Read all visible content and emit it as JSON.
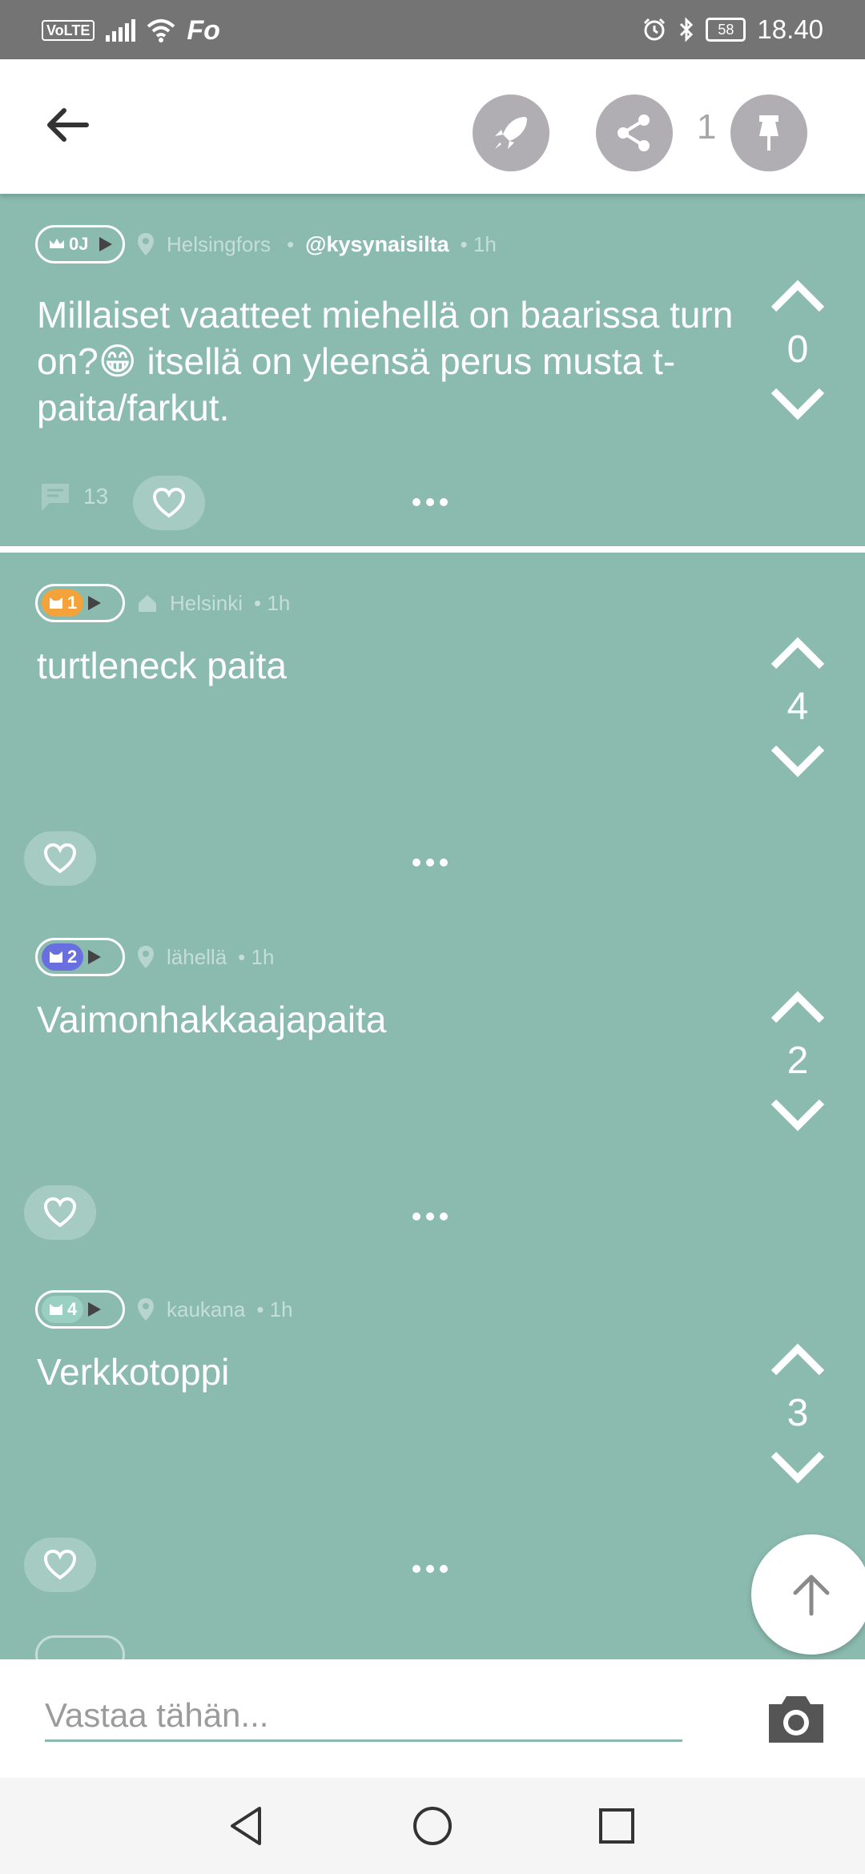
{
  "status_bar": {
    "left": {
      "volte": "VoLTE",
      "carrier_icon": "Fo"
    },
    "right": {
      "battery": "58",
      "time": "18.40"
    }
  },
  "header": {
    "back_icon": "arrow-left-icon",
    "rocket_icon": "rocket-icon",
    "share_icon": "share-icon",
    "share_count": "1",
    "pin_icon": "pin-icon"
  },
  "posts": [
    {
      "badge": "0J",
      "badge_color": "#8bbbaf",
      "location_icon": "map-pin-icon",
      "location": "Helsingfors",
      "separator": "•",
      "username": "@kysynaisilta",
      "time": "• 1h",
      "text": "Millaiset vaatteet miehellä on baarissa turn on?😁 itsellä on yleensä perus musta t-paita/farkut.",
      "votes": "0",
      "comments": "13"
    },
    {
      "badge": "1",
      "badge_color": "#f4a23a",
      "location_icon": "home-icon",
      "location": "Helsinki",
      "time": "• 1h",
      "text": "turtleneck paita",
      "votes": "4"
    },
    {
      "badge": "2",
      "badge_color": "#6a6fe0",
      "location_icon": "map-pin-icon",
      "location": "lähellä",
      "time": "• 1h",
      "text": "Vaimonhakkaajapaita",
      "votes": "2"
    },
    {
      "badge": "4",
      "badge_color": "#9ad0c2",
      "location_icon": "map-pin-icon",
      "location": "kaukana",
      "time": "• 1h",
      "text": "Verkkotoppi",
      "votes": "3"
    }
  ],
  "reply": {
    "placeholder": "Vastaa tähän..."
  },
  "colors": {
    "accent": "#8bbbaf",
    "header_icon_bg": "#b0aeb3"
  }
}
